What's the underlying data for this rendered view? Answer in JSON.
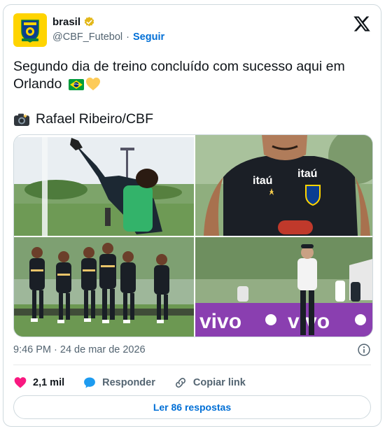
{
  "account": {
    "name": "brasil",
    "handle": "@CBF_Futebol",
    "separator": "·",
    "follow_label": "Seguir"
  },
  "post": {
    "text_line1": "Segundo dia de treino concluído com sucesso aqui em",
    "text_line2": "Orlando",
    "credit": "Rafael Ribeiro/CBF",
    "credit_icon": "camera-icon"
  },
  "images": [
    {
      "name": "goalkeeper-training-photo"
    },
    {
      "name": "player-closeup-photo"
    },
    {
      "name": "team-warmup-photo"
    },
    {
      "name": "coach-photo"
    }
  ],
  "meta": {
    "timestamp": "9:46 PM · 24 de mar de 2026"
  },
  "actions": {
    "likes": "2,1 mil",
    "reply_label": "Responder",
    "copy_link_label": "Copiar link"
  },
  "read_replies_label": "Ler 86 respostas",
  "colors": {
    "accent": "#006fd6",
    "like": "#f91880",
    "brand_yellow": "#ffd400",
    "brand_green": "#009c3b"
  }
}
